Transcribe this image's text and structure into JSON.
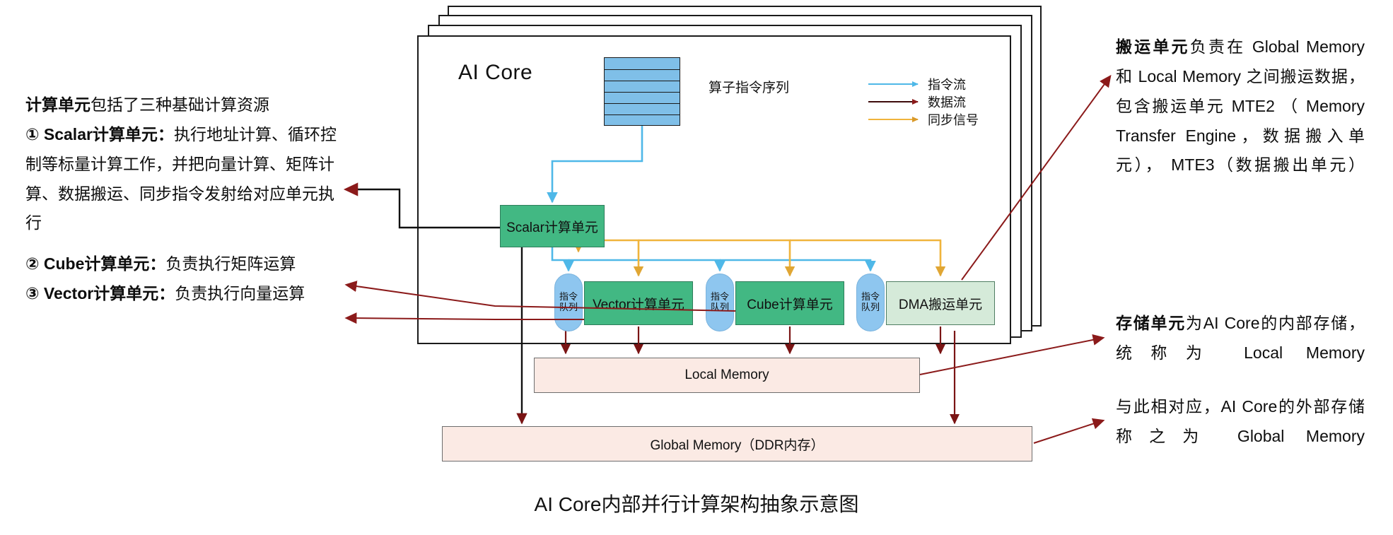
{
  "diagram": {
    "caption": "AI Core内部并行计算架构抽象示意图",
    "core_label": "AI Core",
    "instruction_sequence_label": "算子指令序列",
    "instruction_sequence_rows": 6,
    "blocks": {
      "scalar": "Scalar计算单元",
      "vector": "Vector计算单元",
      "cube": "Cube计算单元",
      "dma": "DMA搬运单元",
      "local_memory": "Local Memory",
      "global_memory": "Global Memory（DDR内存）"
    },
    "queue_label": "指令\n队列",
    "queue_line1": "指令",
    "queue_line2": "队列",
    "legend": [
      {
        "label": "指令流",
        "color": "#4fb8e8"
      },
      {
        "label": "数据流",
        "color": "#4a0f0f"
      },
      {
        "label": "同步信号",
        "color": "#f0b43c"
      }
    ],
    "colors": {
      "instruction_flow": "#4fb8e8",
      "data_flow": "#5c1414",
      "sync_signal": "#f0b43c",
      "annotation_arrow": "#8b1a1a",
      "compute_block": "#42b883",
      "dma_block": "#d5ead9",
      "memory_block": "#fbeae4",
      "queue_pill": "#8ec6ef",
      "instruction_stack": "#7fbfe8"
    }
  },
  "annotations": {
    "left": {
      "heading_bold": "计算单元",
      "heading_rest": "包括了三种基础计算资源",
      "items": [
        {
          "marker": "①",
          "bold": "Scalar计算单元：",
          "text": "执行地址计算、循环控制等标量计算工作，并把向量计算、矩阵计算、数据搬运、同步指令发射给对应单元执行"
        },
        {
          "marker": "②",
          "bold": "Cube计算单元：",
          "text": "负责执行矩阵运算"
        },
        {
          "marker": "③",
          "bold": "Vector计算单元：",
          "text": "负责执行向量运算"
        }
      ]
    },
    "right_top": {
      "bold": "搬运单元",
      "text": "负责在 Global Memory 和 Local  Memory 之间搬运数据，包含搬运单元 MTE2 （ Memory Transfer Engine，数据搬入单元）， MTE3（数据搬出单元）"
    },
    "right_mid": {
      "bold": "存储单元",
      "text": "为AI Core的内部存储，统称为 Local Memory"
    },
    "right_bottom": {
      "text": "与此相对应，AI Core的外部存储称之为 Global Memory"
    }
  }
}
